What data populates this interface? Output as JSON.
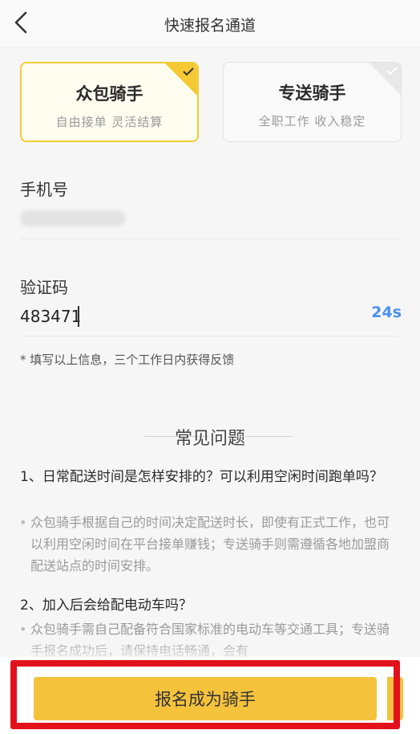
{
  "header": {
    "title": "快速报名通道"
  },
  "cards": [
    {
      "title": "众包骑手",
      "subtitle": "自由接单 灵活结算",
      "selected": true
    },
    {
      "title": "专送骑手",
      "subtitle": "全职工作 收入稳定",
      "selected": false
    }
  ],
  "form": {
    "phone_label": "手机号",
    "code_label": "验证码",
    "code_value": "483471",
    "countdown": "24s",
    "hint": "* 填写以上信息，三个工作日内获得反馈"
  },
  "faq": {
    "heading": "常见问题",
    "items": [
      {
        "question": "1、日常配送时间是怎样安排的？可以利用空闲时间跑单吗？",
        "answer": "众包骑手根据自己的时间决定配送时长，即使有正式工作，也可以利用空闲时间在平台接单赚钱；专送骑手则需遵循各地加盟商配送站点的时间安排。"
      },
      {
        "question": "2、加入后会给配电动车吗？",
        "answer": "众包骑手需自己配备符合国家标准的电动车等交通工具；专送骑手报名成功后，请保持电话畅通，会有"
      }
    ]
  },
  "cta": {
    "label": "报名成为骑手"
  },
  "colors": {
    "accent": "#f5c23c",
    "countdown": "#4b8ff0",
    "highlight": "#e2111b"
  }
}
